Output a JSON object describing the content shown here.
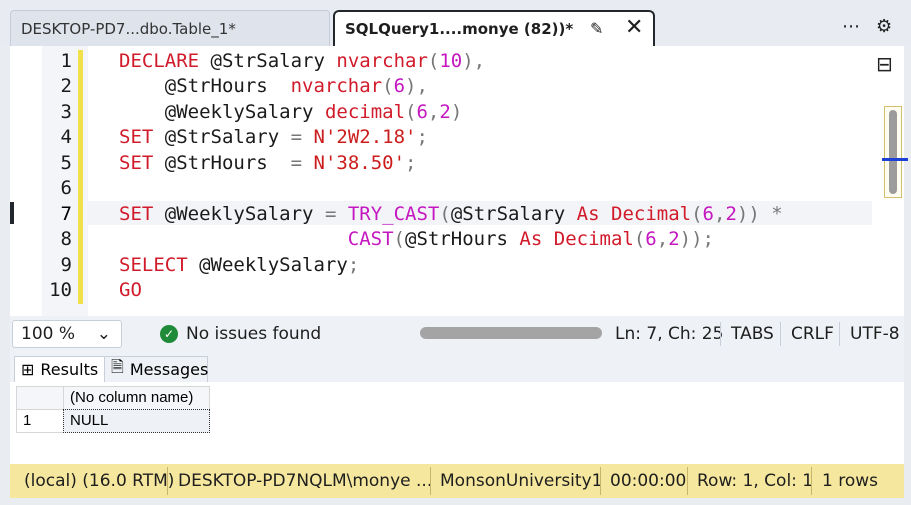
{
  "tabs": [
    {
      "label": "DESKTOP-PD7...dbo.Table_1*",
      "active": false
    },
    {
      "label": "SQLQuery1....monye (82))*",
      "active": true
    }
  ],
  "tab_icons": {
    "pin": "pin-icon",
    "close": "close-icon",
    "more": "more-icon",
    "settings": "gear-icon"
  },
  "editor": {
    "line_numbers": [
      "1",
      "2",
      "3",
      "4",
      "5",
      "6",
      "7",
      "8",
      "9",
      "10"
    ],
    "current_line": 7
  },
  "status": {
    "zoom": "100 %",
    "issues": "No issues found",
    "position": "Ln: 7, Ch: 25",
    "indent": "TABS",
    "line_ending": "CRLF",
    "encoding": "UTF-8"
  },
  "results": {
    "tab_results": "Results",
    "tab_messages": "Messages",
    "column_header": "(No column name)",
    "rows": [
      {
        "index": "1",
        "value": "NULL"
      }
    ]
  },
  "bottom_status": {
    "server": "(local) (16.0 RTM)",
    "user": "DESKTOP-PD7NQLM\\monye ...",
    "database": "MonsonUniversity1",
    "time": "00:00:00",
    "cursor": "Row: 1, Col: 1",
    "rows": "1 rows"
  },
  "colors": {
    "keyword": "#d11a2a",
    "number": "#c417c0",
    "status_bar": "#f5e79e"
  }
}
